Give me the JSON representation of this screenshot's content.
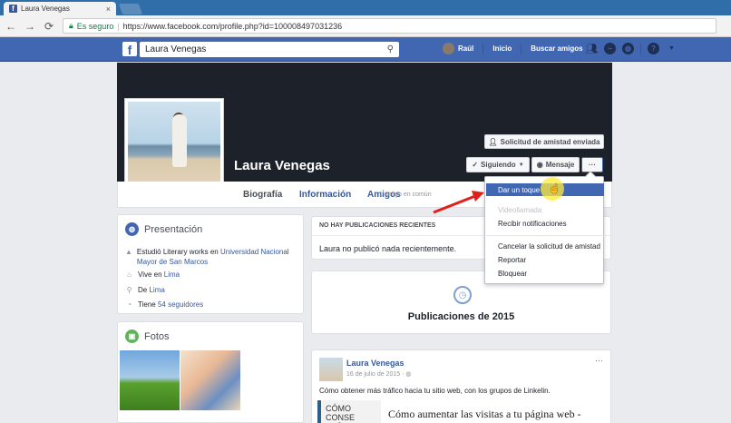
{
  "browser": {
    "tab_title": "Laura Venegas",
    "tab_close": "×",
    "secure_label": "Es seguro",
    "url_host": "https://www.facebook.com",
    "url_path": "/profile.php?id=100008497031236",
    "back_icon": "arrow-left-icon",
    "forward_icon": "arrow-right-icon",
    "reload_icon": "reload-icon"
  },
  "fb_header": {
    "logo": "f",
    "search_value": "Laura Venegas",
    "user_name": "Raúl",
    "home_label": "Inicio",
    "find_friends_label": "Buscar amigos",
    "help_label": "?"
  },
  "profile": {
    "name": "Laura Venegas",
    "friend_request_label": "Solicitud de amistad enviada",
    "following_label": "Siguiendo",
    "message_label": "Mensaje",
    "more_label": "···",
    "tabs": {
      "bio": "Biografía",
      "info": "Información",
      "friends": "Amigos",
      "friends_sub": "1 amigo en común"
    }
  },
  "more_menu": {
    "items": [
      {
        "label": "Dar un toque",
        "state": "active"
      },
      {
        "label": "Videollamada",
        "state": "disabled"
      },
      {
        "label": "Recibir notificaciones",
        "state": "normal"
      },
      {
        "label": "Cancelar la solicitud de amistad",
        "state": "normal"
      },
      {
        "label": "Reportar",
        "state": "normal"
      },
      {
        "label": "Bloquear",
        "state": "normal"
      }
    ]
  },
  "intro": {
    "title": "Presentación",
    "work_prefix": "Estudió Literary works en",
    "work_link": "Universidad Nacional Mayor de San Marcos",
    "lives_prefix": "Vive en",
    "lives_link": "Lima",
    "from_prefix": "De",
    "from_link": "Lima",
    "followers_prefix": "Tiene",
    "followers_link": "54 seguidores"
  },
  "photos": {
    "title": "Fotos"
  },
  "no_posts": {
    "header": "NO HAY PUBLICACIONES RECIENTES",
    "text": "Laura no publicó nada recientemente."
  },
  "pubs": {
    "title": "Publicaciones de 2015"
  },
  "post": {
    "author": "Laura Venegas",
    "date": "16 de julio de 2015 · ",
    "text": "Cómo obtener más tráfico hacia tu sitio web, con los grupos de Linkelin.",
    "img_text": "CÓMO CONSE TRÁFICO WEB",
    "img_headline": "Cómo aumentar las visitas a tu página web - Nelyder Gray CEO",
    "menu": "···"
  },
  "colors": {
    "fb_blue": "#4267b2",
    "link": "#365899",
    "cover": "#1d2129"
  }
}
